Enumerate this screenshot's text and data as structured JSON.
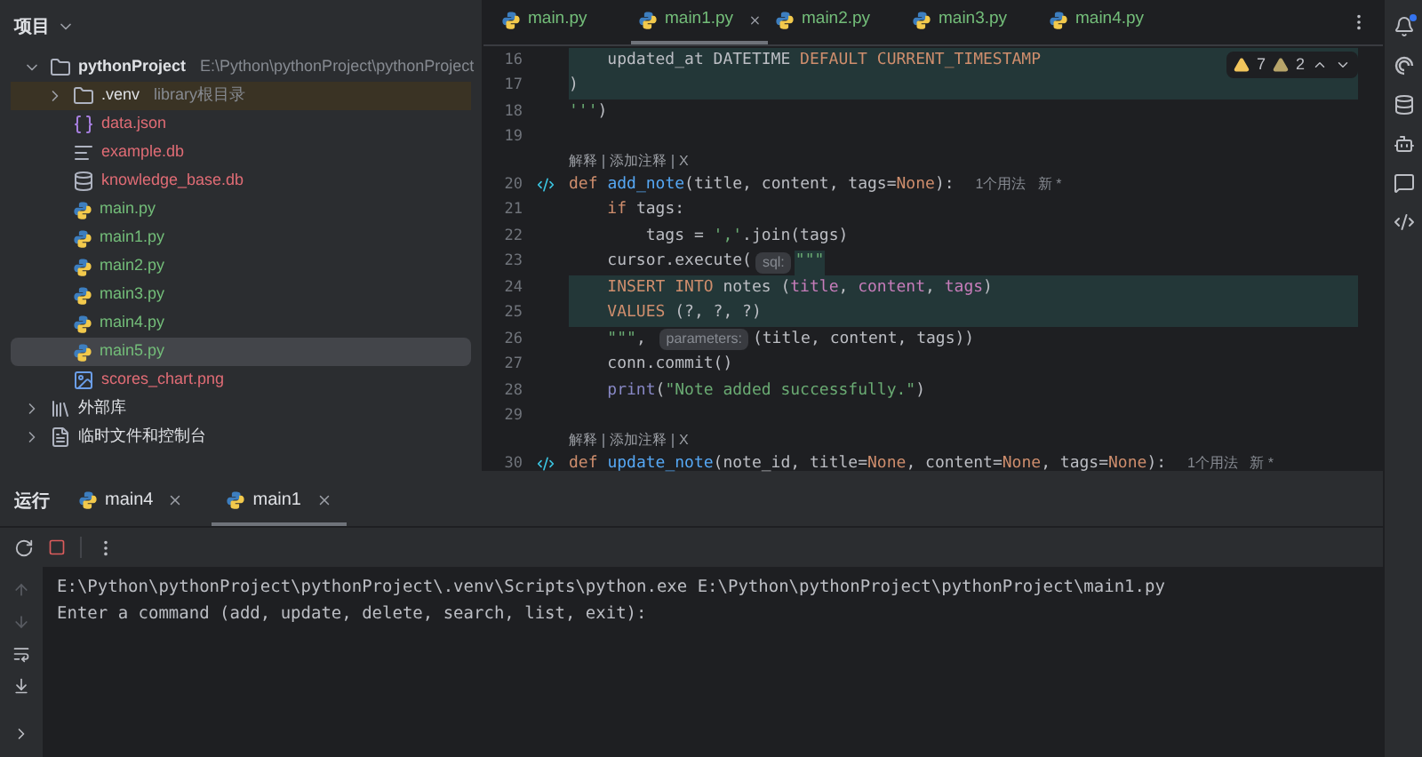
{
  "project_panel": {
    "title": "项目",
    "tree": [
      {
        "label": "pythonProject",
        "kind": "folder",
        "path": "E:\\Python\\pythonProject\\pythonProject",
        "expanded": true,
        "selected": false,
        "bold": true,
        "color": "#dfe1e5",
        "children": [
          {
            "label": ".venv",
            "kind": "folder",
            "note": "library根目录",
            "expanded": false,
            "selected": false,
            "excluded": true,
            "color": "#dfe1e5"
          },
          {
            "label": "data.json",
            "kind": "json",
            "selected": false,
            "color": "#e06c75"
          },
          {
            "label": "example.db",
            "kind": "text",
            "selected": false,
            "color": "#e06c75"
          },
          {
            "label": "knowledge_base.db",
            "kind": "database",
            "selected": false,
            "color": "#e06c75"
          },
          {
            "label": "main.py",
            "kind": "python",
            "selected": false,
            "color": "#73bd79"
          },
          {
            "label": "main1.py",
            "kind": "python",
            "selected": false,
            "color": "#73bd79"
          },
          {
            "label": "main2.py",
            "kind": "python",
            "selected": false,
            "color": "#73bd79"
          },
          {
            "label": "main3.py",
            "kind": "python",
            "selected": false,
            "color": "#73bd79"
          },
          {
            "label": "main4.py",
            "kind": "python",
            "selected": false,
            "color": "#73bd79"
          },
          {
            "label": "main5.py",
            "kind": "python",
            "selected": true,
            "color": "#73bd79"
          },
          {
            "label": "scores_chart.png",
            "kind": "image",
            "selected": false,
            "color": "#e06c75"
          }
        ]
      },
      {
        "label": "外部库",
        "kind": "library",
        "expanded": false,
        "selected": false,
        "color": "#dfe1e5"
      },
      {
        "label": "临时文件和控制台",
        "kind": "scratch",
        "expanded": false,
        "selected": false,
        "color": "#dfe1e5"
      }
    ]
  },
  "editor_tabs": [
    {
      "label": "main.py",
      "selected": false,
      "closable": false
    },
    {
      "label": "main1.py",
      "selected": true,
      "closable": true
    },
    {
      "label": "main2.py",
      "selected": false,
      "closable": false
    },
    {
      "label": "main3.py",
      "selected": false,
      "closable": false
    },
    {
      "label": "main4.py",
      "selected": false,
      "closable": false
    }
  ],
  "inspections": {
    "warnings": "7",
    "weak_warnings": "2"
  },
  "code": [
    {
      "kind": "code",
      "number": "16",
      "highlighted": true,
      "tokens": [
        {
          "kind": "plain",
          "text": "    updated_at DATETIME "
        },
        {
          "kind": "sql",
          "text": "DEFAULT CURRENT_TIMESTAMP"
        }
      ]
    },
    {
      "kind": "code",
      "number": "17",
      "highlighted": true,
      "tokens": [
        {
          "kind": "plain",
          "text": ")"
        }
      ]
    },
    {
      "kind": "code",
      "number": "18",
      "highlighted": false,
      "tokens": [
        {
          "kind": "string",
          "text": "'''"
        },
        {
          "kind": "plain",
          "text": ")"
        }
      ]
    },
    {
      "kind": "code",
      "number": "19"
    },
    {
      "kind": "lens",
      "links": [
        "解释",
        "添加注释",
        "X"
      ]
    },
    {
      "kind": "code",
      "number": "20",
      "highlighted": false,
      "gutter_icon": true,
      "tokens": [
        {
          "kind": "keyword",
          "text": "def "
        },
        {
          "kind": "function",
          "text": "add_note"
        },
        {
          "kind": "plain",
          "text": "(title, content, tags="
        },
        {
          "kind": "keyword",
          "text": "None"
        },
        {
          "kind": "plain",
          "text": "):"
        },
        {
          "kind": "usage",
          "text": "1个用法   新 *"
        }
      ]
    },
    {
      "kind": "code",
      "number": "21",
      "highlighted": false,
      "tokens": [
        {
          "kind": "keyword",
          "text": "    if "
        },
        {
          "kind": "plain",
          "text": "tags:"
        }
      ]
    },
    {
      "kind": "code",
      "number": "22",
      "highlighted": false,
      "tokens": [
        {
          "kind": "plain",
          "text": "        tags = "
        },
        {
          "kind": "string",
          "text": "','"
        },
        {
          "kind": "plain",
          "text": ".join(tags)"
        }
      ]
    },
    {
      "kind": "code",
      "number": "23",
      "highlighted": false,
      "tokens": [
        {
          "kind": "plain",
          "text": "    cursor.execute("
        },
        {
          "kind": "hint",
          "text": "sql:"
        },
        {
          "kind": "string_hl",
          "text": "\"\"\""
        }
      ]
    },
    {
      "kind": "code",
      "number": "24",
      "highlighted": true,
      "tokens": [
        {
          "kind": "sql",
          "text": "    INSERT INTO "
        },
        {
          "kind": "plain",
          "text": "notes ("
        },
        {
          "kind": "column",
          "text": "title"
        },
        {
          "kind": "plain",
          "text": ", "
        },
        {
          "kind": "column",
          "text": "content"
        },
        {
          "kind": "plain",
          "text": ", "
        },
        {
          "kind": "column",
          "text": "tags"
        },
        {
          "kind": "plain",
          "text": ")"
        }
      ]
    },
    {
      "kind": "code",
      "number": "25",
      "highlighted": true,
      "tokens": [
        {
          "kind": "sql",
          "text": "    VALUES "
        },
        {
          "kind": "plain",
          "text": "(?, ?, ?)"
        }
      ]
    },
    {
      "kind": "code",
      "number": "26",
      "highlighted": false,
      "tokens": [
        {
          "kind": "string",
          "text": "    \"\"\""
        },
        {
          "kind": "plain",
          "text": ", "
        },
        {
          "kind": "hint",
          "text": "parameters:"
        },
        {
          "kind": "plain",
          "text": "(title, content, tags))"
        }
      ]
    },
    {
      "kind": "code",
      "number": "27",
      "highlighted": false,
      "tokens": [
        {
          "kind": "plain",
          "text": "    conn.commit()"
        }
      ]
    },
    {
      "kind": "code",
      "number": "28",
      "highlighted": false,
      "tokens": [
        {
          "kind": "builtin",
          "text": "    print"
        },
        {
          "kind": "plain",
          "text": "("
        },
        {
          "kind": "string",
          "text": "\"Note added successfully.\""
        },
        {
          "kind": "plain",
          "text": ")"
        }
      ]
    },
    {
      "kind": "code",
      "number": "29"
    },
    {
      "kind": "lens",
      "links": [
        "解释",
        "添加注释",
        "X"
      ]
    },
    {
      "kind": "code",
      "number": "30",
      "highlighted": false,
      "gutter_icon": true,
      "tokens": [
        {
          "kind": "keyword",
          "text": "def "
        },
        {
          "kind": "function",
          "text": "update_note"
        },
        {
          "kind": "plain",
          "text": "(note_id, title="
        },
        {
          "kind": "keyword",
          "text": "None"
        },
        {
          "kind": "plain",
          "text": ", content="
        },
        {
          "kind": "keyword",
          "text": "None"
        },
        {
          "kind": "plain",
          "text": ", tags="
        },
        {
          "kind": "keyword",
          "text": "None"
        },
        {
          "kind": "plain",
          "text": "):"
        },
        {
          "kind": "usage",
          "text": "1个用法   新 *"
        }
      ]
    }
  ],
  "run_panel": {
    "title": "运行",
    "tabs": [
      {
        "label": "main4",
        "selected": false
      },
      {
        "label": "main1",
        "selected": true
      }
    ],
    "console": [
      "E:\\Python\\pythonProject\\pythonProject\\.venv\\Scripts\\python.exe E:\\Python\\pythonProject\\pythonProject\\main1.py",
      "Enter a command (add, update, delete, search, list, exit):"
    ]
  }
}
